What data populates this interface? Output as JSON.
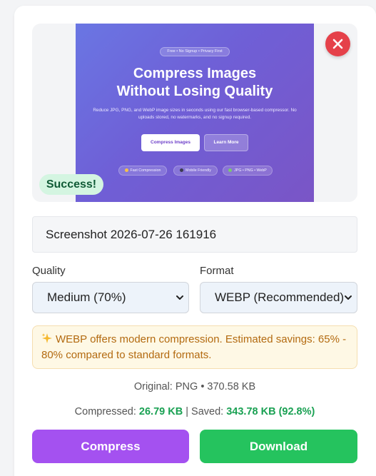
{
  "preview": {
    "pill_text": "Free • No Signup • Privacy First",
    "title_line1": "Compress Images",
    "title_line2": "Without Losing Quality",
    "subtitle": "Reduce JPG, PNG, and WebP image sizes in seconds using our fast browser-based compressor. No uploads stored, no watermarks, and no signup required.",
    "primary_button": "Compress Images",
    "secondary_button": "Learn More",
    "features": [
      "Fast Compression",
      "Mobile Friendly",
      "JPG • PNG • WebP"
    ]
  },
  "status": {
    "success_label": "Success!"
  },
  "file": {
    "name": "Screenshot 2026-07-26 161916"
  },
  "quality": {
    "label": "Quality",
    "selected": "Medium (70%)"
  },
  "format": {
    "label": "Format",
    "selected": "WEBP (Recommended)"
  },
  "notice": {
    "icon": "sparkles-icon",
    "text": "WEBP offers modern compression. Estimated savings: 65% - 80% compared to standard formats."
  },
  "stats": {
    "original_label": "Original:",
    "original_value": "PNG • 370.58 KB",
    "compressed_label": "Compressed:",
    "compressed_value": "26.79 KB",
    "separator": "|",
    "saved_label": "Saved:",
    "saved_value": "343.78 KB (92.8%)"
  },
  "actions": {
    "compress": "Compress",
    "download": "Download"
  },
  "colors": {
    "compress_button": "#a451f0",
    "download_button": "#25c35e",
    "remove_button": "#e5414a",
    "success_badge_bg": "#d4f5e1",
    "notice_bg": "#fef8e5",
    "savings_text": "#1aa153"
  }
}
